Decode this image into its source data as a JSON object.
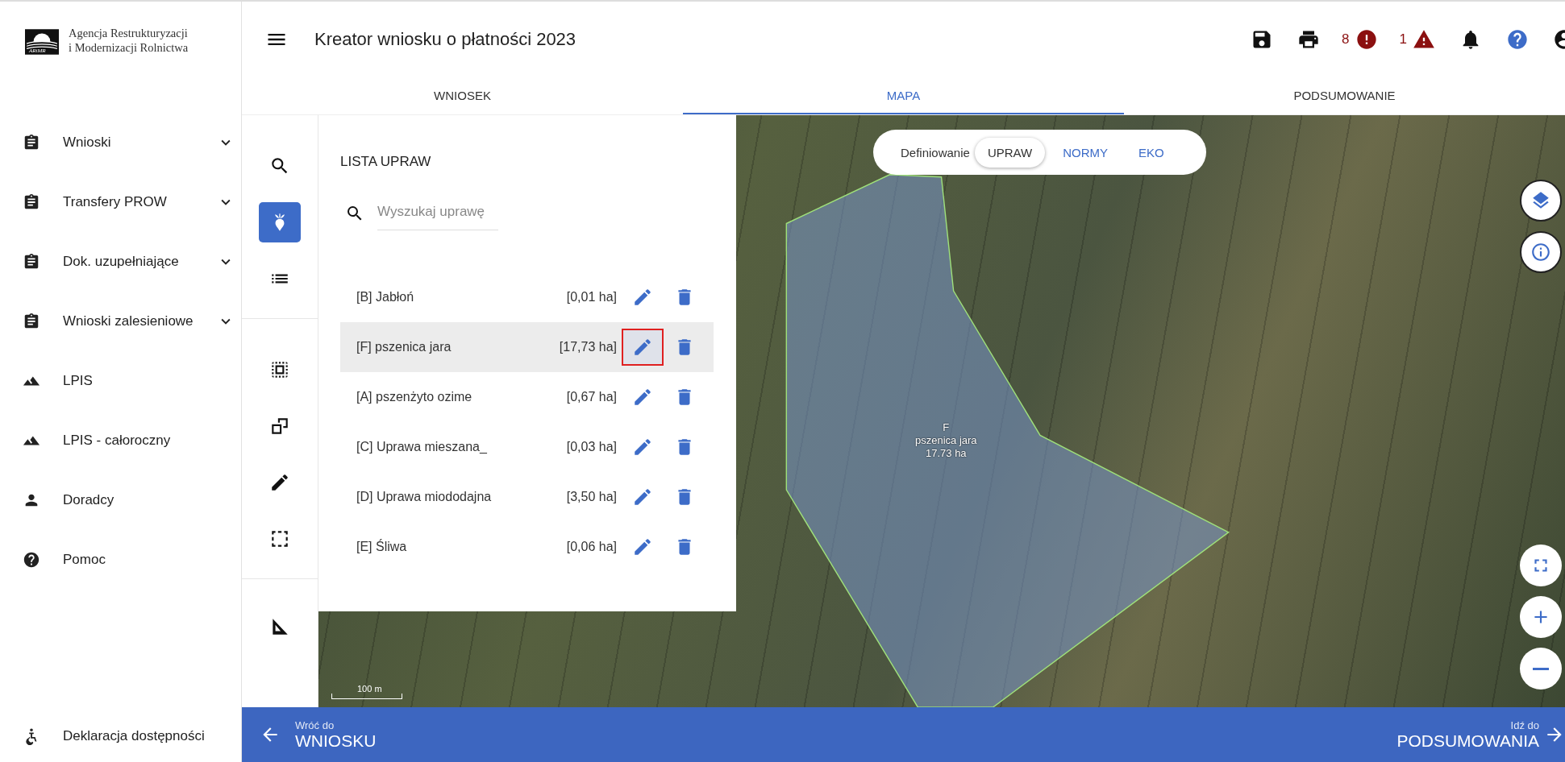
{
  "logo": {
    "mark_text": "ARiMR",
    "name_lines": [
      "Agencja Restrukturyzacji",
      "i Modernizacji Rolnictwa"
    ]
  },
  "header": {
    "title": "Kreator wniosku o płatności 2023",
    "actions": [
      {
        "kind": "save"
      },
      {
        "kind": "print"
      },
      {
        "kind": "error",
        "count": "8"
      },
      {
        "kind": "warning",
        "count": "1"
      },
      {
        "kind": "bell"
      },
      {
        "kind": "help"
      },
      {
        "kind": "account"
      }
    ]
  },
  "tabs": [
    {
      "label": "WNIOSEK",
      "selected": false
    },
    {
      "label": "MAPA",
      "selected": true
    },
    {
      "label": "PODSUMOWANIE",
      "selected": false
    }
  ],
  "sidebar": {
    "items": [
      {
        "kind": "clipboard",
        "label": "Wnioski",
        "expandable": true
      },
      {
        "kind": "clipboard",
        "label": "Transfery PROW",
        "expandable": true
      },
      {
        "kind": "clipboard",
        "label": "Dok. uzupełniające",
        "expandable": true
      },
      {
        "kind": "clipboard",
        "label": "Wnioski zalesieniowe",
        "expandable": true
      },
      {
        "kind": "terrain",
        "label": "LPIS",
        "expandable": false
      },
      {
        "kind": "terrain",
        "label": "LPIS - całoroczny",
        "expandable": false
      },
      {
        "kind": "person",
        "label": "Doradcy",
        "expandable": false
      },
      {
        "kind": "help",
        "label": "Pomoc",
        "expandable": false
      }
    ],
    "footer_item": {
      "kind": "accessibility",
      "label": "Deklaracja dostępności"
    }
  },
  "tool_groups": [
    [
      {
        "kind": "search",
        "selected": false
      },
      {
        "kind": "crop",
        "selected": true
      },
      {
        "kind": "list",
        "selected": false
      }
    ],
    [
      {
        "kind": "select",
        "selected": false
      },
      {
        "kind": "copy",
        "selected": false
      },
      {
        "kind": "edit",
        "selected": false
      },
      {
        "kind": "frame",
        "selected": false
      }
    ],
    [
      {
        "kind": "measure",
        "selected": false
      }
    ]
  ],
  "crop_list": {
    "title": "LISTA UPRAW",
    "search": {
      "placeholder": "Wyszukaj uprawę"
    },
    "rows": [
      {
        "name": "[B] Jabłoń",
        "area": "[0,01 ha]",
        "selected": false,
        "edit_marked": false
      },
      {
        "name": "[F] pszenica jara",
        "area": "[17,73 ha]",
        "selected": true,
        "edit_marked": true
      },
      {
        "name": "[A] pszenżyto ozime",
        "area": "[0,67 ha]",
        "selected": false,
        "edit_marked": false
      },
      {
        "name": "[C] Uprawa mieszana_",
        "area": "[0,03 ha]",
        "selected": false,
        "edit_marked": false
      },
      {
        "name": "[D] Uprawa miododajna",
        "area": "[3,50 ha]",
        "selected": false,
        "edit_marked": false
      },
      {
        "name": "[E] Śliwa",
        "area": "[0,06 ha]",
        "selected": false,
        "edit_marked": false
      }
    ]
  },
  "map": {
    "mode": {
      "label": "Definiowanie",
      "options": [
        {
          "label": "UPRAW",
          "selected": true
        },
        {
          "label": "NORMY",
          "selected": false
        },
        {
          "label": "EKO",
          "selected": false
        }
      ]
    },
    "field_label": {
      "code": "F",
      "name": "pszenica jara",
      "area": "17.73 ha"
    },
    "scale": "100 m",
    "controls": [
      {
        "kind": "layers"
      },
      {
        "kind": "info"
      },
      {
        "kind": "fullscreen"
      },
      {
        "kind": "zoom-in"
      },
      {
        "kind": "zoom-out"
      }
    ]
  },
  "bottom_bar": {
    "back": {
      "caption": "Wróć do",
      "label": "WNIOSKU"
    },
    "next": {
      "caption": "Idź do",
      "label": "PODSUMOWANIA"
    }
  }
}
